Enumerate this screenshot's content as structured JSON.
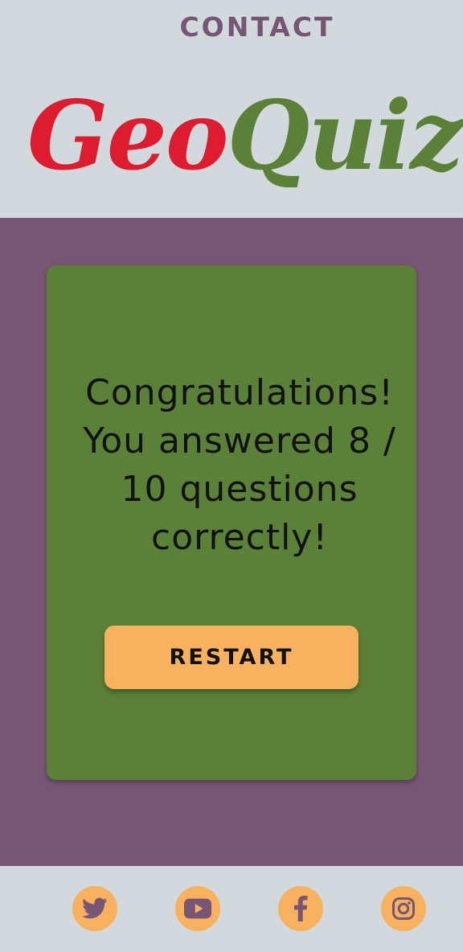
{
  "nav": {
    "contact_label": "CONTACT"
  },
  "logo": {
    "part1": "Geo",
    "part2": "Quiz"
  },
  "result": {
    "message": "Congratulations! You answered 8 / 10 questions correctly!",
    "score": 8,
    "total": 10
  },
  "actions": {
    "restart_label": "RESTART"
  },
  "footer": {
    "social": [
      {
        "icon": "twitter-icon"
      },
      {
        "icon": "youtube-icon"
      },
      {
        "icon": "facebook-icon"
      },
      {
        "icon": "instagram-icon"
      }
    ]
  },
  "colors": {
    "header_bg": "#d1d9dd",
    "main_bg": "#775574",
    "card_bg": "#5b8138",
    "button_bg": "#f8b15f",
    "logo_geo": "#dd1c2f",
    "logo_quiz": "#5b8138",
    "nav_text": "#775574"
  }
}
